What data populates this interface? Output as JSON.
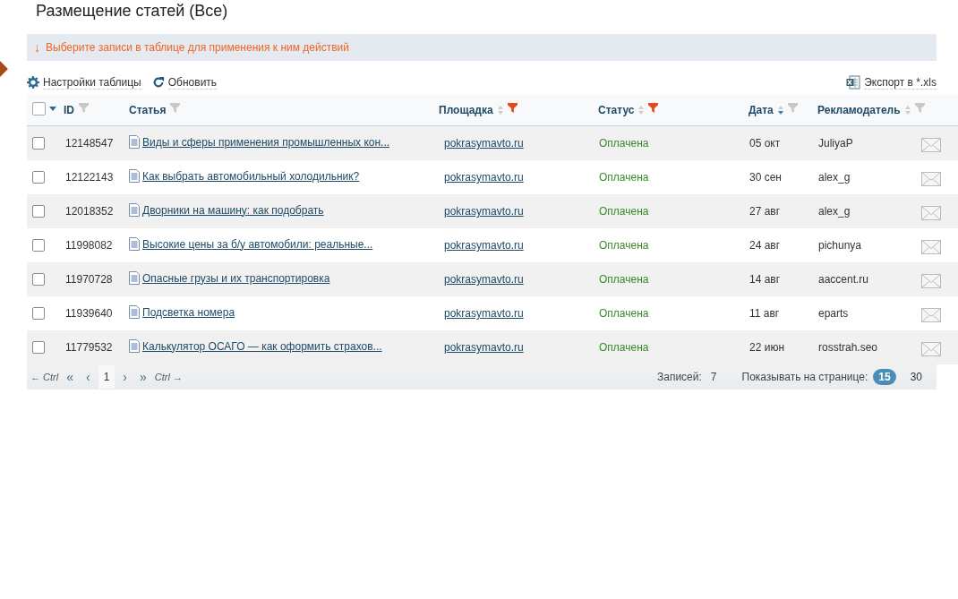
{
  "page": {
    "title": "Размещение статей (Все)"
  },
  "notice": {
    "icon": "↓",
    "text": "Выберите записи в таблице для применения к ним действий"
  },
  "toolbar": {
    "settings": "Настройки таблицы",
    "refresh": "Обновить",
    "export": "Экспорт в *.xls"
  },
  "table": {
    "select_all": {
      "checked": false
    },
    "columns": [
      {
        "label": "ID",
        "sortable": false,
        "filter_active": false
      },
      {
        "label": "Статья",
        "sortable": false,
        "filter_active": false
      },
      {
        "label": "Площадка",
        "sortable": true,
        "sorted": false,
        "filter_active": true
      },
      {
        "label": "Статус",
        "sortable": true,
        "sorted": false,
        "filter_active": true
      },
      {
        "label": "Дата",
        "sortable": true,
        "sorted": true,
        "filter_active": false
      },
      {
        "label": "Рекламодатель",
        "sortable": true,
        "sorted": false,
        "filter_active": false
      }
    ],
    "rows": [
      {
        "checked": false,
        "id": "12148547",
        "article": "Виды и сферы применения промышленных кон...",
        "site": "pokrasymavto.ru",
        "status": "Оплачена",
        "date": "05 окт",
        "advertiser": "JuliyaP"
      },
      {
        "checked": false,
        "id": "12122143",
        "article": "Как выбрать автомобильный холодильник?",
        "site": "pokrasymavto.ru",
        "status": "Оплачена",
        "date": "30 сен",
        "advertiser": "alex_g"
      },
      {
        "checked": false,
        "id": "12018352",
        "article": "Дворники на машину: как подобрать",
        "site": "pokrasymavto.ru",
        "status": "Оплачена",
        "date": "27 авг",
        "advertiser": "alex_g"
      },
      {
        "checked": false,
        "id": "11998082",
        "article": "Высокие цены за б/у автомобили: реальные...",
        "site": "pokrasymavto.ru",
        "status": "Оплачена",
        "date": "24 авг",
        "advertiser": "pichunya"
      },
      {
        "checked": false,
        "id": "11970728",
        "article": "Опасные грузы и их транспортировка",
        "site": "pokrasymavto.ru",
        "status": "Оплачена",
        "date": "14 авг",
        "advertiser": "aaccent.ru"
      },
      {
        "checked": false,
        "id": "11939640",
        "article": "Подсветка номера",
        "site": "pokrasymavto.ru",
        "status": "Оплачена",
        "date": "11 авг",
        "advertiser": "eparts"
      },
      {
        "checked": false,
        "id": "11779532",
        "article": "Калькулятор ОСАГО — как оформить страхов...",
        "site": "pokrasymavto.ru",
        "status": "Оплачена",
        "date": "22 июн",
        "advertiser": "rosstrah.seo"
      }
    ]
  },
  "pagination": {
    "prev_hint": "← Ctrl",
    "first": "«",
    "prev": "‹",
    "pages": [
      {
        "label": "1",
        "selected": true
      }
    ],
    "next": "›",
    "last": "»",
    "next_hint": "Ctrl →",
    "records_label": "Записей:",
    "records_count": "7",
    "per_page_label": "Показывать на странице:",
    "per_page_options": [
      {
        "label": "15",
        "selected": true
      },
      {
        "label": "30",
        "selected": false
      }
    ]
  }
}
